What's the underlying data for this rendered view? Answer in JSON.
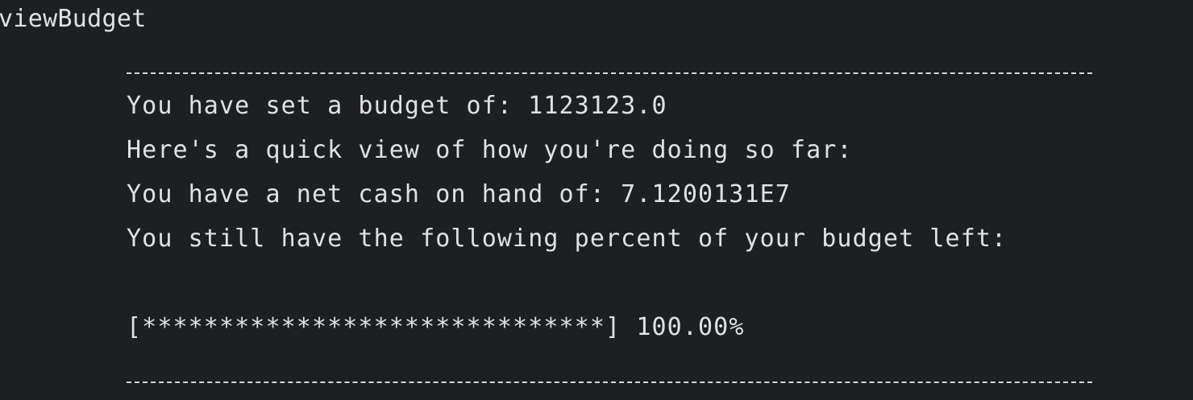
{
  "terminal": {
    "command": "viewBudget",
    "lines": {
      "budget": "You have set a budget of: 1123123.0",
      "quick_view": "Here's a quick view of how you're doing so far:",
      "net_cash": "You have a net cash on hand of: 7.1200131E7",
      "percent_left": "You still have the following percent of your budget left:"
    },
    "progress": {
      "bar": "[******************************]",
      "label": "100.00%",
      "fraction": 1.0
    }
  },
  "colors": {
    "background": "#1e1f22",
    "text": "#dfe1e5"
  }
}
